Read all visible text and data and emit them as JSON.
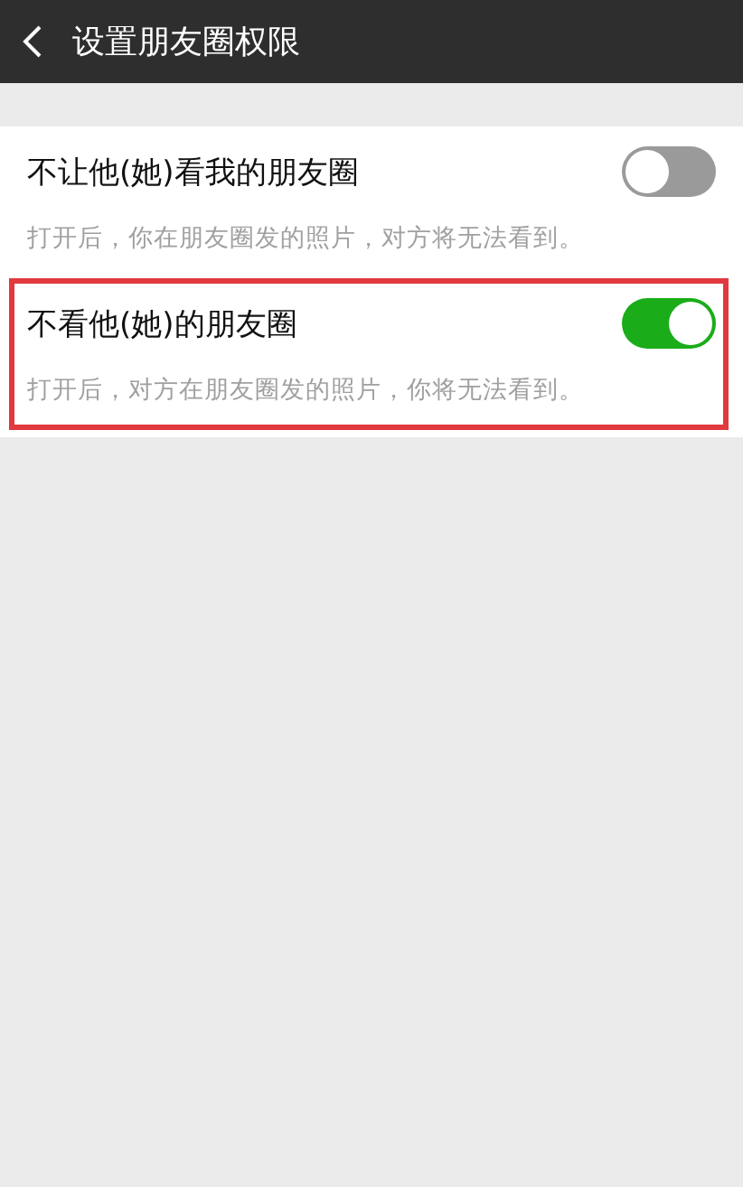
{
  "header": {
    "title": "设置朋友圈权限"
  },
  "settings": [
    {
      "label": "不让他(她)看我的朋友圈",
      "on": false,
      "description": "打开后，你在朋友圈发的照片，对方将无法看到。",
      "highlighted": false
    },
    {
      "label": "不看他(她)的朋友圈",
      "on": true,
      "description": "打开后，对方在朋友圈发的照片，你将无法看到。",
      "highlighted": true
    }
  ]
}
